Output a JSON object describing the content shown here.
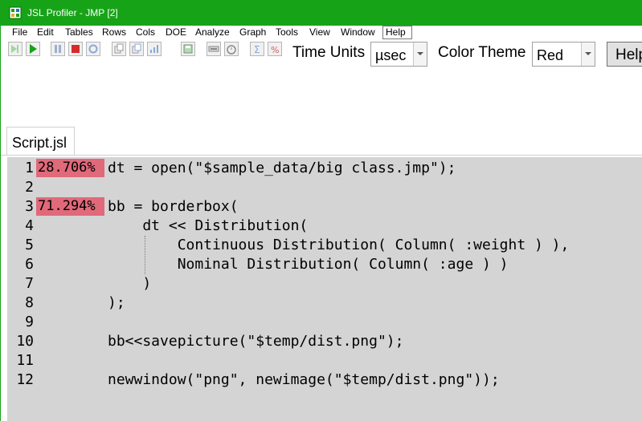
{
  "window": {
    "title": "JSL Profiler - JMP [2]"
  },
  "menu": [
    "File",
    "Edit",
    "Tables",
    "Rows",
    "Cols",
    "DOE",
    "Analyze",
    "Graph",
    "Tools",
    "View",
    "Window",
    "Help"
  ],
  "toolbar": {
    "icons": [
      "step-icon",
      "run-icon",
      "pause-icon",
      "stop-icon",
      "refresh-icon",
      "copy-report-icon",
      "copy-icon",
      "chart-icon",
      "save-icon",
      "export-icon",
      "timer-icon",
      "sum-icon",
      "exclude-icon"
    ],
    "time_units_label": "Time Units",
    "time_units_value": "µsec",
    "color_theme_label": "Color Theme",
    "color_theme_value": "Red",
    "help_label": "Help"
  },
  "tab": {
    "label": "Script.jsl"
  },
  "script": {
    "line_numbers": [
      "1",
      "2",
      "3",
      "4",
      "5",
      "6",
      "7",
      "8",
      "9",
      "10",
      "11",
      "12"
    ],
    "percents": {
      "line1": "28.706%",
      "line3": "71.294%"
    },
    "lines": [
      "dt = open(\"$sample_data/big class.jmp\");",
      "",
      "bb = borderbox(",
      "    dt << Distribution(",
      "        Continuous Distribution( Column( :weight ) ),",
      "        Nominal Distribution( Column( :age ) )",
      "    )",
      ");",
      "",
      "bb<<savepicture(\"$temp/dist.png\");",
      "",
      "newwindow(\"png\", newimage(\"$temp/dist.png\"));"
    ]
  },
  "colors": {
    "titlebar": "#17a317",
    "editor_bg": "#d4d4d4",
    "percent_bar": "#e0697a"
  }
}
